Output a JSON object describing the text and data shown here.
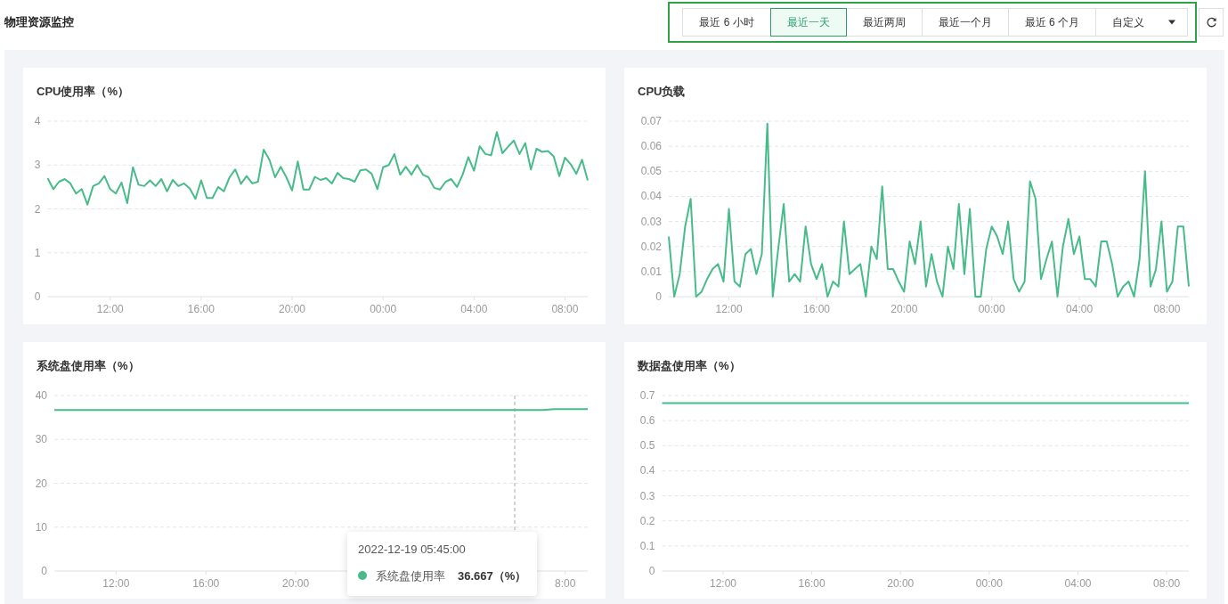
{
  "page_title": "物理资源监控",
  "time_ranges": [
    {
      "label": "最近 6 小时",
      "selected": false,
      "kind": "button"
    },
    {
      "label": "最近一天",
      "selected": true,
      "kind": "button"
    },
    {
      "label": "最近两周",
      "selected": false,
      "kind": "button"
    },
    {
      "label": "最近一个月",
      "selected": false,
      "kind": "button"
    },
    {
      "label": "最近 6 个月",
      "selected": false,
      "kind": "button"
    },
    {
      "label": "自定义",
      "selected": false,
      "kind": "dropdown"
    }
  ],
  "charts": [
    {
      "title": "CPU使用率（%）",
      "chart_data": {
        "type": "line",
        "grid": true,
        "ylim": [
          0,
          4
        ],
        "xlim": [
          "2022-12-18T09:15",
          "2022-12-19T09:00"
        ],
        "yticks": [
          0,
          1,
          2,
          3,
          4
        ],
        "xticks": [
          {
            "value": "2022-12-18T12:00",
            "label": "12:00"
          },
          {
            "value": "2022-12-18T16:00",
            "label": "16:00"
          },
          {
            "value": "2022-12-18T20:00",
            "label": "20:00"
          },
          {
            "value": "2022-12-19T00:00",
            "label": "00:00"
          },
          {
            "value": "2022-12-19T04:00",
            "label": "04:00"
          },
          {
            "value": "2022-12-19T08:00",
            "label": "08:00"
          }
        ],
        "x": [
          "2022-12-18T09:15",
          "2022-12-18T09:30",
          "2022-12-18T09:45",
          "2022-12-18T10:00",
          "2022-12-18T10:15",
          "2022-12-18T10:30",
          "2022-12-18T10:45",
          "2022-12-18T11:00",
          "2022-12-18T11:15",
          "2022-12-18T11:30",
          "2022-12-18T11:45",
          "2022-12-18T12:00",
          "2022-12-18T12:15",
          "2022-12-18T12:30",
          "2022-12-18T12:45",
          "2022-12-18T13:00",
          "2022-12-18T13:15",
          "2022-12-18T13:30",
          "2022-12-18T13:45",
          "2022-12-18T14:00",
          "2022-12-18T14:15",
          "2022-12-18T14:30",
          "2022-12-18T14:45",
          "2022-12-18T15:00",
          "2022-12-18T15:15",
          "2022-12-18T15:30",
          "2022-12-18T15:45",
          "2022-12-18T16:00",
          "2022-12-18T16:15",
          "2022-12-18T16:30",
          "2022-12-18T16:45",
          "2022-12-18T17:00",
          "2022-12-18T17:15",
          "2022-12-18T17:30",
          "2022-12-18T17:45",
          "2022-12-18T18:00",
          "2022-12-18T18:15",
          "2022-12-18T18:30",
          "2022-12-18T18:45",
          "2022-12-18T19:00",
          "2022-12-18T19:15",
          "2022-12-18T19:30",
          "2022-12-18T19:45",
          "2022-12-18T20:00",
          "2022-12-18T20:15",
          "2022-12-18T20:30",
          "2022-12-18T20:45",
          "2022-12-18T21:00",
          "2022-12-18T21:15",
          "2022-12-18T21:30",
          "2022-12-18T21:45",
          "2022-12-18T22:00",
          "2022-12-18T22:15",
          "2022-12-18T22:30",
          "2022-12-18T22:45",
          "2022-12-18T23:00",
          "2022-12-18T23:15",
          "2022-12-18T23:30",
          "2022-12-18T23:45",
          "2022-12-19T00:00",
          "2022-12-19T00:15",
          "2022-12-19T00:30",
          "2022-12-19T00:45",
          "2022-12-19T01:00",
          "2022-12-19T01:15",
          "2022-12-19T01:30",
          "2022-12-19T01:45",
          "2022-12-19T02:00",
          "2022-12-19T02:15",
          "2022-12-19T02:30",
          "2022-12-19T02:45",
          "2022-12-19T03:00",
          "2022-12-19T03:15",
          "2022-12-19T03:30",
          "2022-12-19T03:45",
          "2022-12-19T04:00",
          "2022-12-19T04:15",
          "2022-12-19T04:30",
          "2022-12-19T04:45",
          "2022-12-19T05:00",
          "2022-12-19T05:15",
          "2022-12-19T05:30",
          "2022-12-19T05:45",
          "2022-12-19T06:00",
          "2022-12-19T06:15",
          "2022-12-19T06:30",
          "2022-12-19T06:45",
          "2022-12-19T07:00",
          "2022-12-19T07:15",
          "2022-12-19T07:30",
          "2022-12-19T07:45",
          "2022-12-19T08:00",
          "2022-12-19T08:15",
          "2022-12-19T08:30",
          "2022-12-19T08:45",
          "2022-12-19T09:00"
        ],
        "series": [
          {
            "color": "#48bb8a",
            "values": [
              2.7,
              2.45,
              2.62,
              2.68,
              2.58,
              2.35,
              2.45,
              2.1,
              2.52,
              2.58,
              2.75,
              2.45,
              2.35,
              2.6,
              2.13,
              2.95,
              2.55,
              2.52,
              2.65,
              2.52,
              2.68,
              2.4,
              2.66,
              2.52,
              2.58,
              2.47,
              2.23,
              2.65,
              2.25,
              2.25,
              2.5,
              2.4,
              2.72,
              2.9,
              2.57,
              2.75,
              2.58,
              2.62,
              3.35,
              3.12,
              2.72,
              2.96,
              2.72,
              2.42,
              3.08,
              2.44,
              2.44,
              2.73,
              2.66,
              2.7,
              2.58,
              2.82,
              2.7,
              2.68,
              2.62,
              2.88,
              2.9,
              2.8,
              2.45,
              2.95,
              3.0,
              3.25,
              2.78,
              2.96,
              2.78,
              3.0,
              2.78,
              2.72,
              2.48,
              2.44,
              2.62,
              2.68,
              2.5,
              2.78,
              3.18,
              2.87,
              3.43,
              3.25,
              3.22,
              3.75,
              3.27,
              3.42,
              3.56,
              3.25,
              3.5,
              2.9,
              3.37,
              3.3,
              3.32,
              3.2,
              2.75,
              3.17,
              3.02,
              2.8,
              3.12,
              2.65
            ]
          }
        ]
      }
    },
    {
      "title": "CPU负载",
      "chart_data": {
        "type": "line",
        "grid": true,
        "ylim": [
          0,
          0.07
        ],
        "xlim": [
          "2022-12-18T09:15",
          "2022-12-19T09:00"
        ],
        "yticks": [
          {
            "value": 0,
            "label": "0"
          },
          {
            "value": 0.01,
            "label": "0.01"
          },
          {
            "value": 0.02,
            "label": "0.02"
          },
          {
            "value": 0.03,
            "label": "0.03"
          },
          {
            "value": 0.04,
            "label": "0.04"
          },
          {
            "value": 0.05,
            "label": "0.05"
          },
          {
            "value": 0.06,
            "label": "0.06"
          },
          {
            "value": 0.07,
            "label": "0.07"
          }
        ],
        "xticks": [
          {
            "value": "2022-12-18T12:00",
            "label": "12:00"
          },
          {
            "value": "2022-12-18T16:00",
            "label": "16:00"
          },
          {
            "value": "2022-12-18T20:00",
            "label": "20:00"
          },
          {
            "value": "2022-12-19T00:00",
            "label": "00:00"
          },
          {
            "value": "2022-12-19T04:00",
            "label": "04:00"
          },
          {
            "value": "2022-12-19T08:00",
            "label": "08:00"
          }
        ],
        "x": [
          "2022-12-18T09:15",
          "2022-12-18T09:30",
          "2022-12-18T09:45",
          "2022-12-18T10:00",
          "2022-12-18T10:15",
          "2022-12-18T10:30",
          "2022-12-18T10:45",
          "2022-12-18T11:00",
          "2022-12-18T11:15",
          "2022-12-18T11:30",
          "2022-12-18T11:45",
          "2022-12-18T12:00",
          "2022-12-18T12:15",
          "2022-12-18T12:30",
          "2022-12-18T12:45",
          "2022-12-18T13:00",
          "2022-12-18T13:15",
          "2022-12-18T13:30",
          "2022-12-18T13:45",
          "2022-12-18T14:00",
          "2022-12-18T14:15",
          "2022-12-18T14:30",
          "2022-12-18T14:45",
          "2022-12-18T15:00",
          "2022-12-18T15:15",
          "2022-12-18T15:30",
          "2022-12-18T15:45",
          "2022-12-18T16:00",
          "2022-12-18T16:15",
          "2022-12-18T16:30",
          "2022-12-18T16:45",
          "2022-12-18T17:00",
          "2022-12-18T17:15",
          "2022-12-18T17:30",
          "2022-12-18T17:45",
          "2022-12-18T18:00",
          "2022-12-18T18:15",
          "2022-12-18T18:30",
          "2022-12-18T18:45",
          "2022-12-18T19:00",
          "2022-12-18T19:15",
          "2022-12-18T19:30",
          "2022-12-18T19:45",
          "2022-12-18T20:00",
          "2022-12-18T20:15",
          "2022-12-18T20:30",
          "2022-12-18T20:45",
          "2022-12-18T21:00",
          "2022-12-18T21:15",
          "2022-12-18T21:30",
          "2022-12-18T21:45",
          "2022-12-18T22:00",
          "2022-12-18T22:15",
          "2022-12-18T22:30",
          "2022-12-18T22:45",
          "2022-12-18T23:00",
          "2022-12-18T23:15",
          "2022-12-18T23:30",
          "2022-12-18T23:45",
          "2022-12-19T00:00",
          "2022-12-19T00:15",
          "2022-12-19T00:30",
          "2022-12-19T00:45",
          "2022-12-19T01:00",
          "2022-12-19T01:15",
          "2022-12-19T01:30",
          "2022-12-19T01:45",
          "2022-12-19T02:00",
          "2022-12-19T02:15",
          "2022-12-19T02:30",
          "2022-12-19T02:45",
          "2022-12-19T03:00",
          "2022-12-19T03:15",
          "2022-12-19T03:30",
          "2022-12-19T03:45",
          "2022-12-19T04:00",
          "2022-12-19T04:15",
          "2022-12-19T04:30",
          "2022-12-19T04:45",
          "2022-12-19T05:00",
          "2022-12-19T05:15",
          "2022-12-19T05:30",
          "2022-12-19T05:45",
          "2022-12-19T06:00",
          "2022-12-19T06:15",
          "2022-12-19T06:30",
          "2022-12-19T06:45",
          "2022-12-19T07:00",
          "2022-12-19T07:15",
          "2022-12-19T07:30",
          "2022-12-19T07:45",
          "2022-12-19T08:00",
          "2022-12-19T08:15",
          "2022-12-19T08:30",
          "2022-12-19T08:45",
          "2022-12-19T09:00"
        ],
        "series": [
          {
            "color": "#48bb8a",
            "values": [
              0.024,
              0,
              0.009,
              0.028,
              0.039,
              0,
              0.002,
              0.007,
              0.011,
              0.013,
              0.006,
              0.035,
              0.006,
              0.004,
              0.017,
              0.019,
              0.009,
              0.017,
              0.069,
              0,
              0.019,
              0.037,
              0.006,
              0.009,
              0.006,
              0.028,
              0.013,
              0.007,
              0.013,
              0,
              0.006,
              0.004,
              0.03,
              0.009,
              0.011,
              0.013,
              0,
              0.02,
              0.015,
              0.044,
              0.011,
              0.011,
              0.006,
              0.002,
              0.022,
              0.013,
              0.03,
              0.004,
              0.017,
              0.006,
              0,
              0.02,
              0.011,
              0.037,
              0.009,
              0.035,
              0,
              0,
              0.019,
              0.028,
              0.024,
              0.017,
              0.03,
              0.007,
              0.002,
              0.006,
              0.046,
              0.039,
              0.007,
              0.015,
              0.022,
              0,
              0.02,
              0.031,
              0.017,
              0.024,
              0.007,
              0.007,
              0.004,
              0.022,
              0.022,
              0.013,
              0,
              0.004,
              0.006,
              0,
              0.015,
              0.05,
              0.004,
              0.011,
              0.03,
              0.002,
              0.006,
              0.028,
              0.028,
              0.004
            ]
          }
        ]
      }
    },
    {
      "title": "系统盘使用率（%）",
      "chart_data": {
        "type": "line",
        "grid": true,
        "ylim": [
          0,
          40
        ],
        "xlim": [
          "2022-12-18T09:15",
          "2022-12-19T09:00"
        ],
        "yticks": [
          0,
          10,
          20,
          30,
          40
        ],
        "xticks": [
          {
            "value": "2022-12-18T12:00",
            "label": "12:00"
          },
          {
            "value": "2022-12-18T16:00",
            "label": "16:00"
          },
          {
            "value": "2022-12-18T20:00",
            "label": "20:00"
          },
          {
            "value": "2022-12-19T08:00",
            "label": "8:00"
          }
        ],
        "x": [
          "2022-12-18T09:15",
          "2022-12-18T10:00",
          "2022-12-18T11:00",
          "2022-12-18T12:00",
          "2022-12-18T13:00",
          "2022-12-18T14:00",
          "2022-12-18T15:00",
          "2022-12-18T16:00",
          "2022-12-18T17:00",
          "2022-12-18T18:00",
          "2022-12-18T19:00",
          "2022-12-18T20:00",
          "2022-12-18T21:00",
          "2022-12-18T22:00",
          "2022-12-18T23:00",
          "2022-12-19T00:00",
          "2022-12-19T01:00",
          "2022-12-19T02:00",
          "2022-12-19T03:00",
          "2022-12-19T04:00",
          "2022-12-19T05:00",
          "2022-12-19T06:00",
          "2022-12-19T07:00",
          "2022-12-19T07:30",
          "2022-12-19T08:00",
          "2022-12-19T09:00"
        ],
        "series": [
          {
            "color": "#48bb8a",
            "values": [
              36.7,
              36.7,
              36.7,
              36.7,
              36.7,
              36.7,
              36.7,
              36.7,
              36.7,
              36.7,
              36.7,
              36.7,
              36.7,
              36.7,
              36.7,
              36.7,
              36.7,
              36.7,
              36.7,
              36.7,
              36.7,
              36.7,
              36.7,
              36.9,
              36.9,
              36.9
            ]
          }
        ],
        "ref_lines": [
          {
            "axis": "x",
            "value": "2022-12-19T05:45"
          }
        ]
      },
      "tooltip": {
        "time": "2022-12-19 05:45:00",
        "series": "系统盘使用率",
        "value": "36.667（%）",
        "color": "#48bb8a"
      }
    },
    {
      "title": "数据盘使用率（%）",
      "chart_data": {
        "type": "line",
        "grid": true,
        "ylim": [
          0,
          0.7
        ],
        "xlim": [
          "2022-12-18T09:15",
          "2022-12-19T09:00"
        ],
        "yticks": [
          {
            "value": 0,
            "label": "0"
          },
          {
            "value": 0.1,
            "label": "0.1"
          },
          {
            "value": 0.2,
            "label": "0.2"
          },
          {
            "value": 0.3,
            "label": "0.3"
          },
          {
            "value": 0.4,
            "label": "0.4"
          },
          {
            "value": 0.5,
            "label": "0.5"
          },
          {
            "value": 0.6,
            "label": "0.6"
          },
          {
            "value": 0.7,
            "label": "0.7"
          }
        ],
        "xticks": [
          {
            "value": "2022-12-18T12:00",
            "label": "12:00"
          },
          {
            "value": "2022-12-18T16:00",
            "label": "16:00"
          },
          {
            "value": "2022-12-18T20:00",
            "label": "20:00"
          },
          {
            "value": "2022-12-19T00:00",
            "label": "00:00"
          },
          {
            "value": "2022-12-19T04:00",
            "label": "04:00"
          },
          {
            "value": "2022-12-19T08:00",
            "label": "08:00"
          }
        ],
        "x": [
          "2022-12-18T09:15",
          "2022-12-18T12:00",
          "2022-12-18T16:00",
          "2022-12-18T20:00",
          "2022-12-19T00:00",
          "2022-12-19T04:00",
          "2022-12-19T08:00",
          "2022-12-19T09:00"
        ],
        "series": [
          {
            "color": "#48bb8a",
            "values": [
              0.67,
              0.67,
              0.67,
              0.67,
              0.67,
              0.67,
              0.67,
              0.67
            ]
          }
        ]
      }
    }
  ]
}
